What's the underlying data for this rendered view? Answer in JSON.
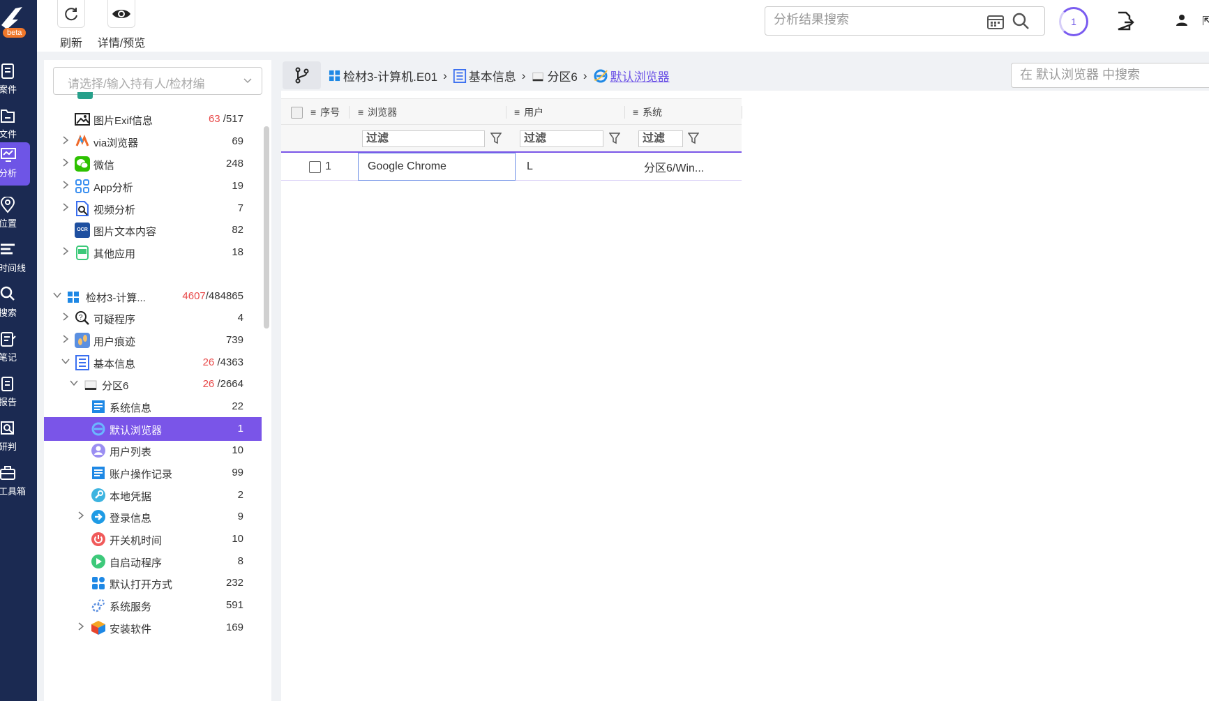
{
  "app": {
    "logo_badge": "beta"
  },
  "nav": [
    {
      "label": "案件",
      "icon": "case-icon"
    },
    {
      "label": "文件",
      "icon": "folder-icon"
    },
    {
      "label": "分析",
      "icon": "analysis-icon",
      "active": true
    },
    {
      "label": "位置",
      "icon": "location-pin-icon"
    },
    {
      "label": "时间线",
      "icon": "timeline-icon"
    },
    {
      "label": "搜索",
      "icon": "search-icon"
    },
    {
      "label": "笔记",
      "icon": "notes-icon"
    },
    {
      "label": "报告",
      "icon": "report-icon"
    },
    {
      "label": "研判",
      "icon": "judge-icon"
    },
    {
      "label": "工具箱",
      "icon": "toolbox-icon"
    }
  ],
  "toolbar": {
    "refresh_label": "刷新",
    "preview_label": "详情/预览"
  },
  "top_search": {
    "placeholder": "分析结果搜索"
  },
  "task_count": "1",
  "tree": {
    "select_placeholder": "请选择/输入持有人/检材编",
    "rows": [
      {
        "label": "图片Exif信息",
        "count_red": "63",
        "count_total": "/517",
        "icon": "image-icon"
      },
      {
        "label": "via浏览器",
        "count": "69",
        "icon": "via-browser-icon"
      },
      {
        "label": "微信",
        "count": "248",
        "icon": "wechat-icon"
      },
      {
        "label": "App分析",
        "count": "19",
        "icon": "app-grid-icon"
      },
      {
        "label": "视频分析",
        "count": "7",
        "icon": "video-analysis-icon"
      },
      {
        "label": "图片文本内容",
        "count": "82",
        "icon": "ocr-icon",
        "ocr_text": "OCR"
      },
      {
        "label": "其他应用",
        "count": "18",
        "icon": "other-apps-icon"
      },
      {
        "label": "检材3-计算...",
        "count_red": "4607",
        "count_total": "/484865",
        "icon": "windows-icon"
      },
      {
        "label": "可疑程序",
        "count": "4",
        "icon": "suspicious-program-icon"
      },
      {
        "label": "用户痕迹",
        "count": "739",
        "icon": "user-traces-icon"
      },
      {
        "label": "基本信息",
        "count_red": "26",
        "count_total": "/4363",
        "icon": "basic-info-icon"
      },
      {
        "label": "分区6",
        "count_red": "26",
        "count_total": "/2664",
        "icon": "partition-icon"
      },
      {
        "label": "系统信息",
        "count": "22",
        "icon": "system-info-icon"
      },
      {
        "label": "默认浏览器",
        "count": "1",
        "icon": "ie-browser-icon"
      },
      {
        "label": "用户列表",
        "count": "10",
        "icon": "user-list-icon"
      },
      {
        "label": "账户操作记录",
        "count": "99",
        "icon": "account-log-icon"
      },
      {
        "label": "本地凭据",
        "count": "2",
        "icon": "credential-icon"
      },
      {
        "label": "登录信息",
        "count": "9",
        "icon": "login-icon"
      },
      {
        "label": "开关机时间",
        "count": "10",
        "icon": "power-icon"
      },
      {
        "label": "自启动程序",
        "count": "8",
        "icon": "autostart-icon"
      },
      {
        "label": "默认打开方式",
        "count": "232",
        "icon": "default-open-icon"
      },
      {
        "label": "系统服务",
        "count": "591",
        "icon": "services-icon"
      },
      {
        "label": "安装软件",
        "count": "169",
        "icon": "installed-software-icon"
      }
    ]
  },
  "breadcrumb": {
    "items": [
      "检材3-计算机.E01",
      "基本信息",
      "分区6",
      "默认浏览器"
    ]
  },
  "panel_search": {
    "placeholder": "在 默认浏览器 中搜索"
  },
  "grid": {
    "columns": [
      "序号",
      "浏览器",
      "用户",
      "系统"
    ],
    "filter_label": "过滤",
    "rows": [
      {
        "index": "1",
        "browser": "Google Chrome",
        "user": "L",
        "system": "分区6/Win..."
      }
    ]
  },
  "colors": {
    "nav_bg": "#1b2a52",
    "accent": "#6e55e6",
    "selected_row": "#7a55e8",
    "count_red": "#e84a4a"
  }
}
